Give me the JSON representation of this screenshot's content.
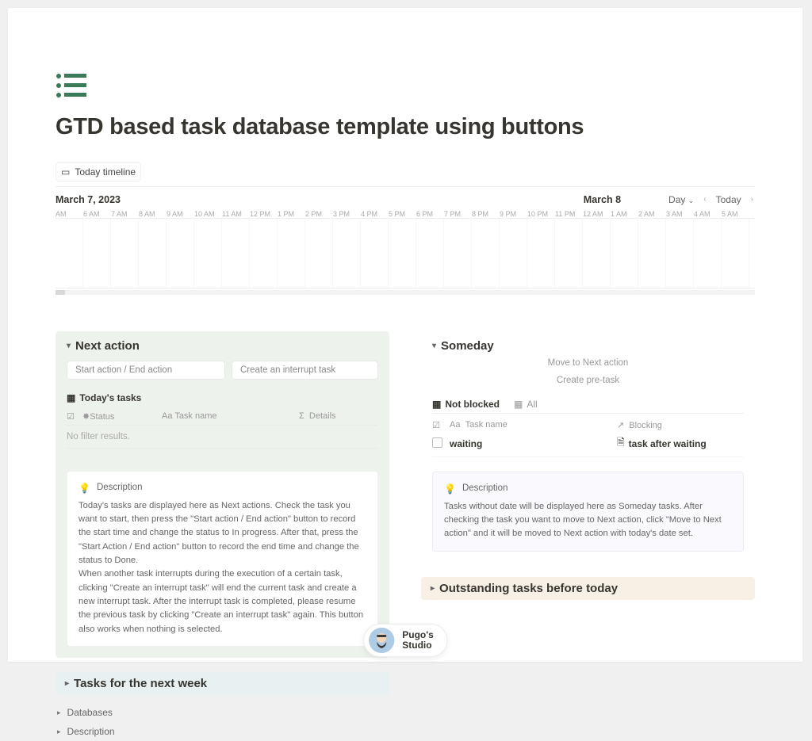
{
  "title": "GTD based task database template using buttons",
  "timeline": {
    "tab_label": "Today timeline",
    "date_left": "March 7, 2023",
    "date_right": "March 8",
    "range_label": "Day",
    "today_label": "Today",
    "hours": [
      "AM",
      "6 AM",
      "7 AM",
      "8 AM",
      "9 AM",
      "10 AM",
      "11 AM",
      "12 PM",
      "1 PM",
      "2 PM",
      "3 PM",
      "4 PM",
      "5 PM",
      "6 PM",
      "7 PM",
      "8 PM",
      "9 PM",
      "10 PM",
      "11 PM",
      "12 AM",
      "1 AM",
      "2 AM",
      "3 AM",
      "4 AM",
      "5 AM"
    ]
  },
  "next_action": {
    "heading": "Next action",
    "btn_start": "Start action / End action",
    "btn_interrupt": "Create an interrupt task",
    "tab_today": "Today's tasks",
    "col_status": "Status",
    "col_taskname": "Task name",
    "col_details": "Details",
    "no_filter": "No filter results.",
    "desc_heading": "Description",
    "desc_body": "Today's tasks are displayed here as Next actions. Check the task you want to start, then press the \"Start action / End action\" button to record the start time and change the status to In progress. After that, press the \"Start Action / End action\" button to record the end time and change the status to Done.\nWhen another task interrupts during the execution of a certain task, clicking \"Create an interrupt task\" will end the current task and create a new interrupt task. After the interrupt task is completed, please resume the previous task by clicking \"Create an interrupt task\" again. This button also works when nothing is selected."
  },
  "tasks_week_heading": "Tasks for the next week",
  "link_databases": "Databases",
  "link_description": "Description",
  "someday": {
    "heading": "Someday",
    "btn_move": "Move to Next action",
    "btn_pretask": "Create pre-task",
    "tab_notblocked": "Not blocked",
    "tab_all": "All",
    "col_taskname": "Task name",
    "col_blocking": "Blocking",
    "row_waiting": "waiting",
    "row_blocking": "task after waiting",
    "desc_heading": "Description",
    "desc_body": "Tasks without date will be displayed here as Someday tasks. After checking the task you want to move to Next action, click \"Move to Next action\" and it will be moved to Next action with today's date set."
  },
  "outstanding_heading": "Outstanding tasks before today",
  "footer": {
    "name1": "Pugo's",
    "name2": "Studio"
  }
}
